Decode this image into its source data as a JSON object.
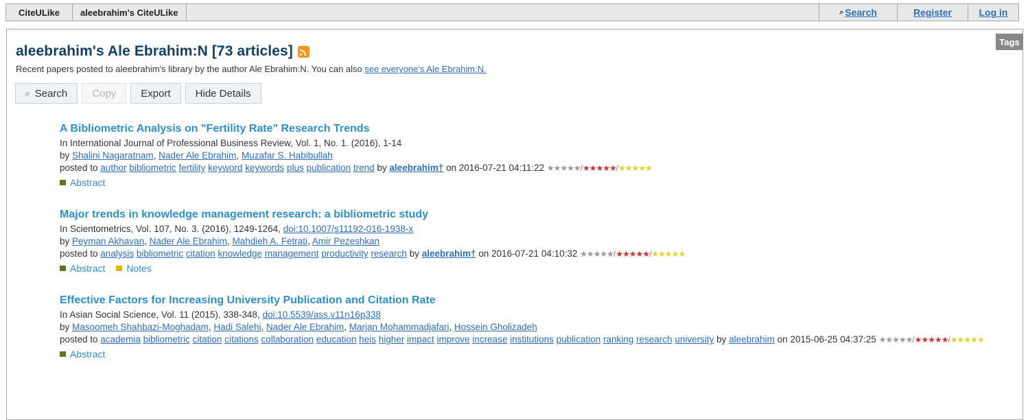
{
  "nav": {
    "tabs": [
      "CiteULike",
      "aleebrahim's CiteULike"
    ],
    "search": "Search",
    "register": "Register",
    "login": "Log in"
  },
  "tags_tab": "Tags",
  "header": {
    "title": "aleebrahim's Ale Ebrahim:N [73 articles]",
    "subtitle_text": "Recent papers posted to aleebrahim's library by the author Ale Ebrahim:N. You can also ",
    "subtitle_link": "see everyone's Ale Ebrahim:N."
  },
  "toolbar": {
    "search": "Search",
    "copy": "Copy",
    "export": "Export",
    "hide_details": "Hide Details"
  },
  "articles": [
    {
      "title": "A Bibliometric Analysis on \"Fertility Rate\" Research Trends",
      "citation": "In International Journal of Professional Business Review, Vol. 1, No. 1. (2016), 1-14",
      "doi": "",
      "authors": [
        "Shalini Nagaratnam",
        "Nader Ale Ebrahim",
        "Muzafar S. Habibullah"
      ],
      "tags": [
        "author",
        "bibliometric",
        "fertility",
        "keyword",
        "keywords",
        "plus",
        "publication",
        "trend"
      ],
      "posted_by": "aleebrahim†",
      "date": "2016-07-21 04:11:22",
      "extras": [
        "Abstract"
      ]
    },
    {
      "title": "Major trends in knowledge management research: a bibliometric study",
      "citation": "In Scientometrics, Vol. 107, No. 3. (2016), 1249-1264,",
      "doi": "doi:10.1007/s11192-016-1938-x",
      "authors": [
        "Peyman Akhavan",
        "Nader Ale Ebrahim",
        "Mahdieh A. Fetrati",
        "Amir Pezeshkan"
      ],
      "tags": [
        "analysis",
        "bibliometric",
        "citation",
        "knowledge",
        "management",
        "productivity",
        "research"
      ],
      "posted_by": "aleebrahim†",
      "date": "2016-07-21 04:10:32",
      "extras": [
        "Abstract",
        "Notes"
      ]
    },
    {
      "title": "Effective Factors for Increasing University Publication and Citation Rate",
      "citation": "In Asian Social Science, Vol. 11 (2015), 338-348,",
      "doi": "doi:10.5539/ass.v11n16p338",
      "authors": [
        "Masoomeh Shahbazi-Moghadam",
        "Hadi Salehi",
        "Nader Ale Ebrahim",
        "Marjan Mohammadjafari",
        "Hossein Gholizadeh"
      ],
      "tags": [
        "academia",
        "bibliometric",
        "citation",
        "citations",
        "collaboration",
        "education",
        "heis",
        "higher",
        "impact",
        "improve",
        "increase",
        "institutions",
        "publication",
        "ranking",
        "research",
        "university"
      ],
      "posted_by": "aleebrahim",
      "date": "2015-06-25 04:37:25",
      "extras": [
        "Abstract"
      ]
    }
  ],
  "labels": {
    "by": "by",
    "posted_to": "posted to",
    "on": "on",
    "stars": "★★★★★",
    "slash": "/"
  },
  "colors": {
    "title": "#123e6a",
    "link": "#2a6fc0",
    "article_title": "#2a8fd6",
    "tag": "#7a1a1a",
    "abstract_marker": "#5a7a1a",
    "notes_marker": "#e8b800"
  }
}
